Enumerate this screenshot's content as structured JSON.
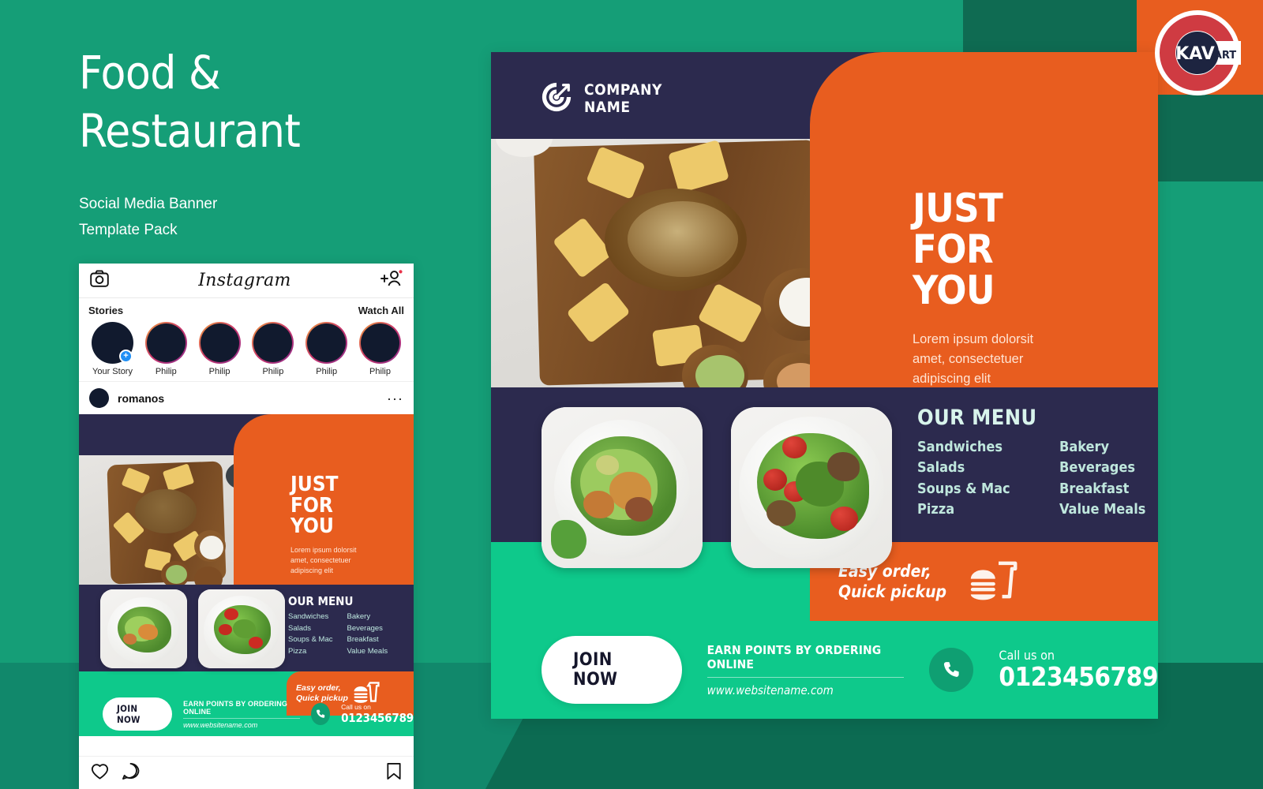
{
  "colors": {
    "green": "#159e77",
    "green_bright": "#0ec98b",
    "green_dark": "#0c6b52",
    "orange": "#e85d1f",
    "navy": "#2c2a4e",
    "mint": "#bfe7dd",
    "red": "#cf3b42"
  },
  "left_panel": {
    "title_line1": "Food &",
    "title_line2": "Restaurant",
    "subtitle_line1": "Social Media Banner",
    "subtitle_line2": "Template Pack"
  },
  "watermark": {
    "kav": "KAV",
    "art": "ART"
  },
  "instagram": {
    "app_name": "Instagram",
    "camera_icon": "camera-icon",
    "add_person_icon": "add-person-icon",
    "stories_label": "Stories",
    "watch_all_label": "Watch All",
    "stories": [
      {
        "name": "Your Story",
        "has_ring": false,
        "has_plus": true
      },
      {
        "name": "Philip",
        "has_ring": true,
        "has_plus": false
      },
      {
        "name": "Philip",
        "has_ring": true,
        "has_plus": false
      },
      {
        "name": "Philip",
        "has_ring": true,
        "has_plus": false
      },
      {
        "name": "Philip",
        "has_ring": true,
        "has_plus": false
      },
      {
        "name": "Philip",
        "has_ring": true,
        "has_plus": false
      }
    ],
    "post_username": "romanos",
    "more_options": "···",
    "actions": {
      "like_icon": "heart-icon",
      "comment_icon": "comment-icon",
      "save_icon": "bookmark-icon"
    }
  },
  "banner": {
    "brand": {
      "logo_icon": "target-arrow-icon",
      "name_line1": "COMPANY",
      "name_line2": "NAME"
    },
    "hero": {
      "title_line1": "JUST",
      "title_line2": "FOR",
      "title_line3": "YOU",
      "body_line1": "Lorem ipsum dolorsit",
      "body_line2": "amet, consectetuer",
      "body_line3": "adipiscing elit"
    },
    "menu": {
      "heading": "OUR MENU",
      "column1": [
        "Sandwiches",
        "Salads",
        "Soups & Mac",
        "Pizza"
      ],
      "column2": [
        "Bakery",
        "Beverages",
        "Breakfast",
        "Value Meals"
      ]
    },
    "easy": {
      "line1": "Easy order,",
      "line2": "Quick pickup",
      "icon": "burger-drink-icon"
    },
    "footer": {
      "join_label": "JOIN NOW",
      "earn_text": "EARN POINTS BY ORDERING ONLINE",
      "website": "www.websitename.com",
      "phone_icon": "phone-icon",
      "call_label": "Call us on",
      "phone_number": "0123456789"
    }
  }
}
